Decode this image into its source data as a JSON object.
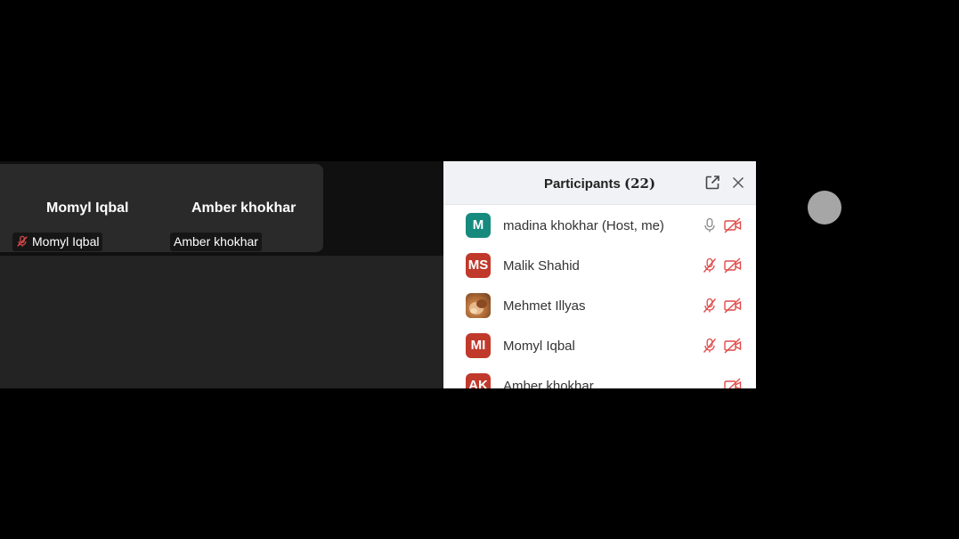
{
  "video": {
    "tiles": [
      {
        "display_name": "Momyl Iqbal",
        "tag": "Momyl Iqbal",
        "muted": true
      },
      {
        "display_name": "Amber khokhar",
        "tag": "Amber khokhar",
        "muted": false
      }
    ]
  },
  "participants": {
    "title": "Participants",
    "count": "(22)",
    "popout_icon": "popout-icon",
    "close_icon": "close-icon",
    "list": [
      {
        "avatar_text": "M",
        "avatar_color": "#178a7e",
        "name": "madina khokhar (Host, me)",
        "mic": "mic-on",
        "cam": "video-off"
      },
      {
        "avatar_text": "MS",
        "avatar_color": "#c0392b",
        "name": "Malik Shahid",
        "mic": "mic-muted",
        "cam": "video-off"
      },
      {
        "avatar_text": "",
        "avatar_color": "#b5703a",
        "name": "Mehmet Illyas",
        "mic": "mic-muted",
        "cam": "video-off",
        "photo": true
      },
      {
        "avatar_text": "MI",
        "avatar_color": "#c0392b",
        "name": "Momyl Iqbal",
        "mic": "mic-muted",
        "cam": "video-off"
      },
      {
        "avatar_text": "AK",
        "avatar_color": "#c0392b",
        "name": "Amber khokhar",
        "mic": "none",
        "cam": "video-off"
      }
    ]
  },
  "colors": {
    "muted_red": "#e04a4a",
    "accent_teal": "#178a7e"
  }
}
